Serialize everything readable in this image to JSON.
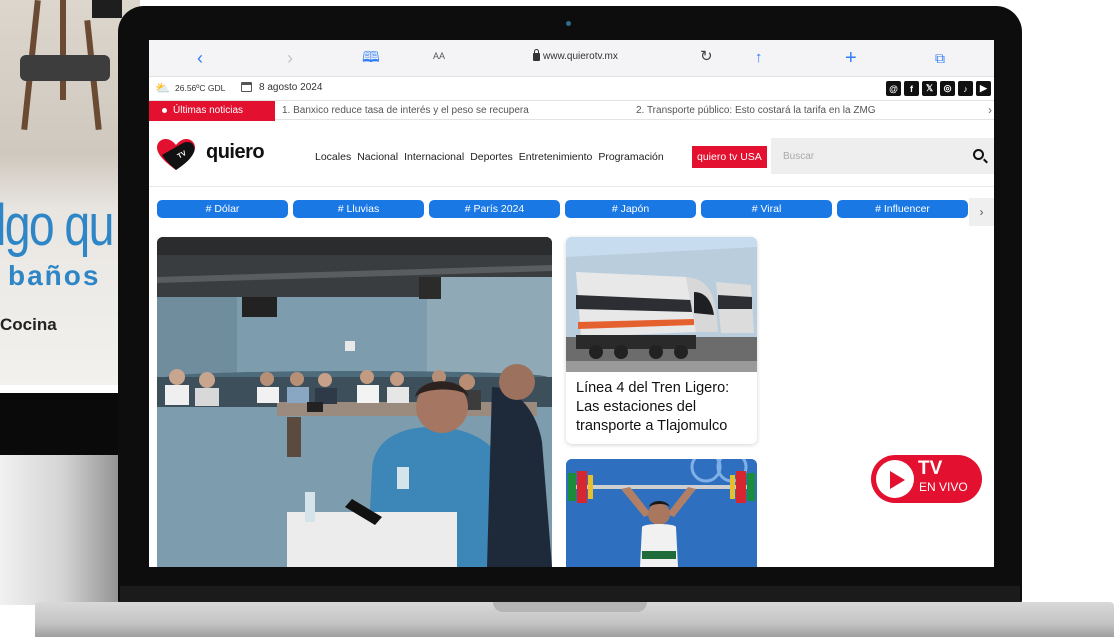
{
  "background": {
    "promo_big": "lgo qu",
    "promo_sub": "baños",
    "promo_cocina": "Cocina"
  },
  "browser": {
    "aa": "AA",
    "url": "www.quierotv.mx"
  },
  "topbar": {
    "temperature": "26.56ºC GDL",
    "date": "8 agosto 2024",
    "socials": [
      "threads-icon",
      "facebook-icon",
      "x-icon",
      "instagram-icon",
      "tiktok-icon",
      "youtube-icon"
    ]
  },
  "ticker": {
    "label": "Últimas noticias",
    "items": [
      "1. Banxico reduce tasa de interés y el peso se recupera",
      "2. Transporte público: Esto costará la tarifa en la ZMG"
    ]
  },
  "header": {
    "logo": "quiero",
    "nav": [
      "Locales",
      "Nacional",
      "Internacional",
      "Deportes",
      "Entretenimiento",
      "Programación"
    ],
    "usa_button": "quiero tv USA",
    "search_placeholder": "Buscar"
  },
  "tags": [
    "# Dólar",
    "# Lluvias",
    "# París 2024",
    "# Japón",
    "# Viral",
    "# Influencer"
  ],
  "articles": {
    "card1_title": "Línea 4 del Tren Ligero: Las estaciones del transporte a Tlajomulco"
  },
  "live": {
    "tv": "TV",
    "envivo": "EN VIVO"
  },
  "colors": {
    "brand_red": "#e3102f",
    "tag_blue": "#1a78e5",
    "link_blue": "#2f7ef7"
  }
}
